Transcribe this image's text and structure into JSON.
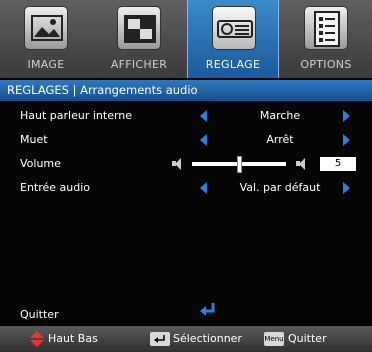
{
  "tabs": [
    {
      "label": "IMAGE",
      "icon": "picture-frame-icon",
      "active": false
    },
    {
      "label": "AFFICHER",
      "icon": "display-screen-icon",
      "active": false
    },
    {
      "label": "REGLAGE",
      "icon": "projector-icon",
      "active": true
    },
    {
      "label": "OPTIONS",
      "icon": "checklist-icon",
      "active": false
    }
  ],
  "title": "REGLAGES | Arrangements audio",
  "rows": {
    "speaker": {
      "label": "Haut parleur interne",
      "value": "Marche"
    },
    "mute": {
      "label": "Muet",
      "value": "Arrêt"
    },
    "volume": {
      "label": "Volume",
      "value": "5",
      "level": 0.5
    },
    "input": {
      "label": "Entrée audio",
      "value": "Val. par défaut"
    }
  },
  "quit_label": "Quitter",
  "help": {
    "nav": "Haut Bas",
    "select": "Sélectionner",
    "menu_key": "Menu",
    "quit": "Quitter"
  },
  "colors": {
    "accent": "#2e7fe0",
    "active_tab": "#2a72b8",
    "enter_icon": "#2e7fe0"
  }
}
